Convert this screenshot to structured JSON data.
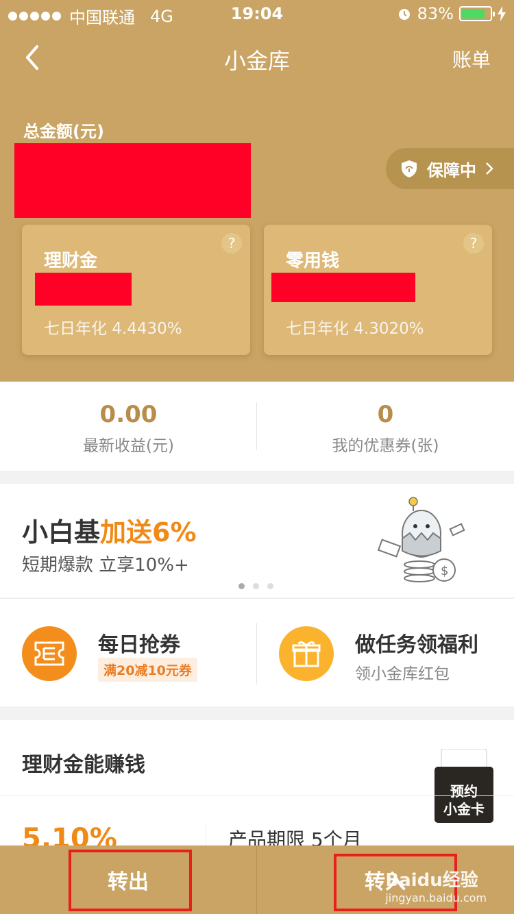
{
  "status_bar": {
    "carrier": "中国联通",
    "network": "4G",
    "time": "19:04",
    "battery": "83%",
    "battery_level": 0.83
  },
  "nav": {
    "title": "小金库",
    "bill_label": "账单"
  },
  "total": {
    "label": "总金额(元)"
  },
  "guarantee": {
    "label": "保障中"
  },
  "cards": [
    {
      "name": "理财金",
      "rate": "七日年化 4.4430%"
    },
    {
      "name": "零用钱",
      "rate": "七日年化 4.3020%"
    }
  ],
  "stats": [
    {
      "value": "0.00",
      "label": "最新收益(元)"
    },
    {
      "value": "0",
      "label": "我的优惠券(张)"
    }
  ],
  "banner": {
    "headline_main": "小白基",
    "headline_accent": "加送6%",
    "subtitle": "短期爆款 立享10%+"
  },
  "promos": [
    {
      "title": "每日抢券",
      "tag": "满20减10元券"
    },
    {
      "title": "做任务领福利",
      "subtitle": "领小金库红包"
    }
  ],
  "section": {
    "title": "理财金能赚钱",
    "rate": "5.10%",
    "term": "产品期限 5个月",
    "badge_line1": "预约",
    "badge_line2": "小金卡"
  },
  "bottom": {
    "transfer_out": "转出",
    "transfer_in": "转入"
  },
  "watermark": {
    "brand": "Baidu经验",
    "url": "jingyan.baidu.com"
  },
  "colors": {
    "gold": "#caa464",
    "accent": "#f08a16",
    "highlight": "#e8201c"
  }
}
